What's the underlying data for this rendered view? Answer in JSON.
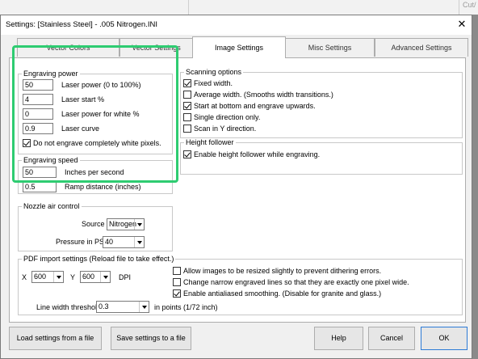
{
  "background": {
    "peek_label": "Cut/"
  },
  "window": {
    "title": "Settings: [Stainless Steel] - .005 Nitrogen.INI",
    "close_glyph": "✕"
  },
  "tabs": [
    {
      "label": "Vector Colors"
    },
    {
      "label": "Vector Settings"
    },
    {
      "label": "Image Settings",
      "active": true
    },
    {
      "label": "Misc Settings"
    },
    {
      "label": "Advanced Settings"
    }
  ],
  "engraving_power": {
    "title": "Engraving power",
    "rows": [
      {
        "value": "50",
        "label": "Laser power (0 to 100%)"
      },
      {
        "value": "4",
        "label": "Laser start %"
      },
      {
        "value": "0",
        "label": "Laser power for white %"
      },
      {
        "value": "0.9",
        "label": "Laser curve"
      }
    ],
    "skip_white": {
      "label": "Do not engrave completely white pixels.",
      "checked": true
    }
  },
  "engraving_speed": {
    "title": "Engraving speed",
    "rows": [
      {
        "value": "50",
        "label": "Inches per second"
      },
      {
        "value": "0.5",
        "label": "Ramp distance (inches)"
      }
    ]
  },
  "scanning": {
    "title": "Scanning options",
    "options": [
      {
        "label": "Fixed width.",
        "checked": true
      },
      {
        "label": "Average width. (Smooths width transitions.)",
        "checked": false
      },
      {
        "label": "Start at bottom and engrave upwards.",
        "checked": true
      },
      {
        "label": "Single direction only.",
        "checked": false
      },
      {
        "label": "Scan in Y direction.",
        "checked": false
      }
    ]
  },
  "height_follower": {
    "title": "Height follower",
    "option": {
      "label": "Enable height follower while engraving.",
      "checked": true
    }
  },
  "nozzle": {
    "title": "Nozzle air control",
    "source_label": "Source",
    "source_value": "Nitrogen",
    "pressure_label": "Pressure in PSI",
    "pressure_value": "40"
  },
  "pdf": {
    "title": "PDF import settings (Reload file to take effect.)",
    "x_label": "X",
    "x_value": "600",
    "y_label": "Y",
    "y_value": "600",
    "dpi_label": "DPI",
    "options": [
      {
        "label": "Allow images to be resized slightly to prevent dithering errors.",
        "checked": false
      },
      {
        "label": "Change narrow engraved lines so that they are exactly one pixel wide.",
        "checked": false
      },
      {
        "label": "Enable antialiased smoothing. (Disable for granite and glass.)",
        "checked": true
      }
    ],
    "line_width_label": "Line width threshold",
    "line_width_value": "0.3",
    "line_width_unit": "in points (1/72 inch)"
  },
  "buttons": {
    "load": "Load settings from a file",
    "save": "Save settings to a file",
    "help": "Help",
    "cancel": "Cancel",
    "ok": "OK"
  },
  "colors": {
    "highlight": "#2ecc71",
    "default_button_border": "#2d7bd6"
  }
}
